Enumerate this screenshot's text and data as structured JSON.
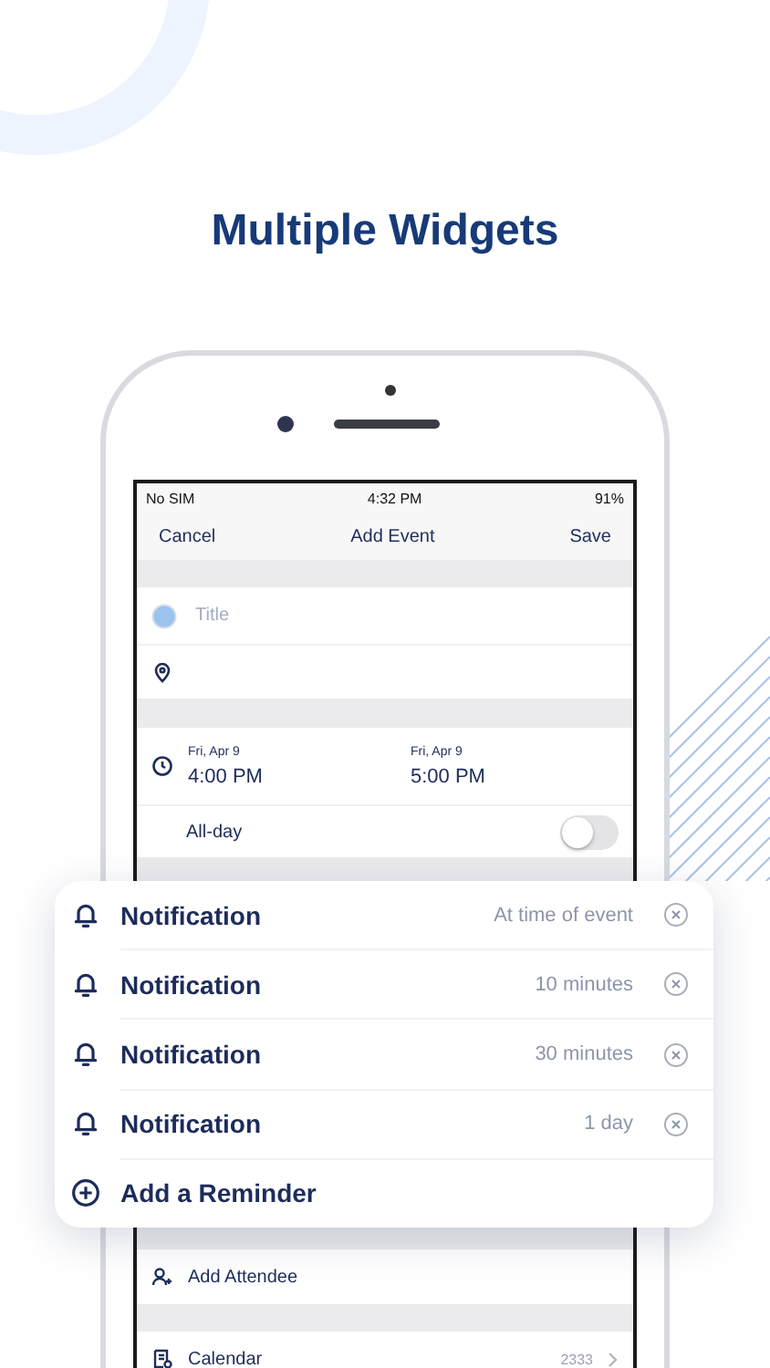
{
  "headline": "Multiple Widgets",
  "status_bar": {
    "carrier": "No SIM",
    "time": "4:32 PM",
    "battery": "91%"
  },
  "nav": {
    "cancel": "Cancel",
    "title": "Add Event",
    "save": "Save"
  },
  "title_field": {
    "placeholder": "Title"
  },
  "start": {
    "date": "Fri, Apr 9",
    "time": "4:00 PM"
  },
  "end": {
    "date": "Fri, Apr 9",
    "time": "5:00 PM"
  },
  "all_day": {
    "label": "All-day",
    "on": false
  },
  "notifications": [
    {
      "label": "Notification",
      "value": "At time of event"
    },
    {
      "label": "Notification",
      "value": "10 minutes"
    },
    {
      "label": "Notification",
      "value": "30 minutes"
    },
    {
      "label": "Notification",
      "value": "1 day"
    }
  ],
  "add_reminder": "Add a Reminder",
  "add_attendee": "Add Attendee",
  "calendar": {
    "label": "Calendar",
    "value": "2333"
  }
}
